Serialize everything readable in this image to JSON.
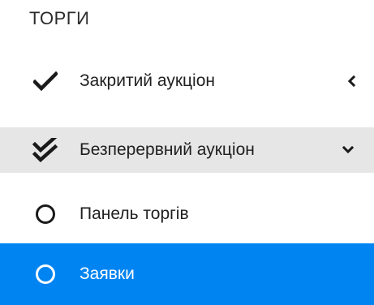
{
  "section": {
    "title": "ТОРГИ"
  },
  "menu": {
    "items": [
      {
        "label": "Закритий аукціон",
        "icon": "check-icon",
        "chevron": "chevron-left-icon"
      },
      {
        "label": "Безперервний аукціон",
        "icon": "double-check-icon",
        "chevron": "chevron-down-icon"
      },
      {
        "label": "Панель торгів",
        "icon": "circle-outline-icon"
      },
      {
        "label": "Заявки",
        "icon": "circle-outline-icon"
      }
    ]
  },
  "colors": {
    "highlight_bg": "#e6e6e6",
    "active_bg": "#0084f2",
    "active_text": "#ffffff",
    "text": "#1f1f1f"
  }
}
